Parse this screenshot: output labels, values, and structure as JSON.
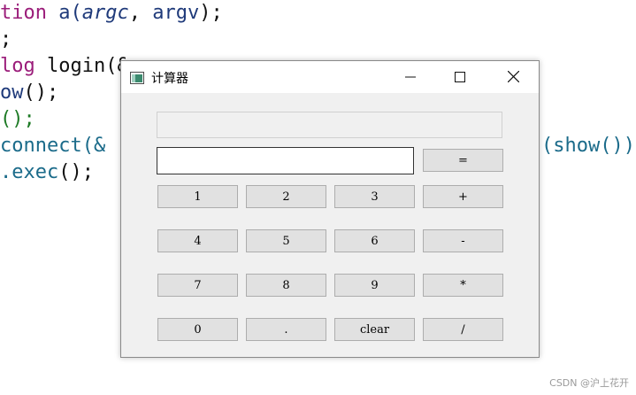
{
  "code": {
    "l1_kw": "tion",
    "l1_fn": " a(",
    "l1_a1": "argc",
    "l1_sep": ", ",
    "l1_a2": "argv",
    "l1_end": ");",
    "l2": ";",
    "l3_kw": "log",
    "l3_rest": " login(&",
    "l4_fn": "ow",
    "l4_rest": "();",
    "l5": "();",
    "l6_a": "connect(&",
    "l6_b": "(show())",
    "l7_fn": ".exec",
    "l7_rest": "();"
  },
  "window": {
    "title": "计算器"
  },
  "calculator": {
    "input_value": "",
    "equals": "=",
    "keys": [
      "1",
      "2",
      "3",
      "+",
      "4",
      "5",
      "6",
      "-",
      "7",
      "8",
      "9",
      "*",
      "0",
      ".",
      "clear",
      "/"
    ]
  },
  "watermark": "CSDN @沪上花开",
  "colors": {
    "keyword": "#9b1d7a",
    "function": "#1f3a7a",
    "green": "#1d7a25",
    "button_bg": "#e1e1e1",
    "window_bg": "#f0f0f0"
  }
}
